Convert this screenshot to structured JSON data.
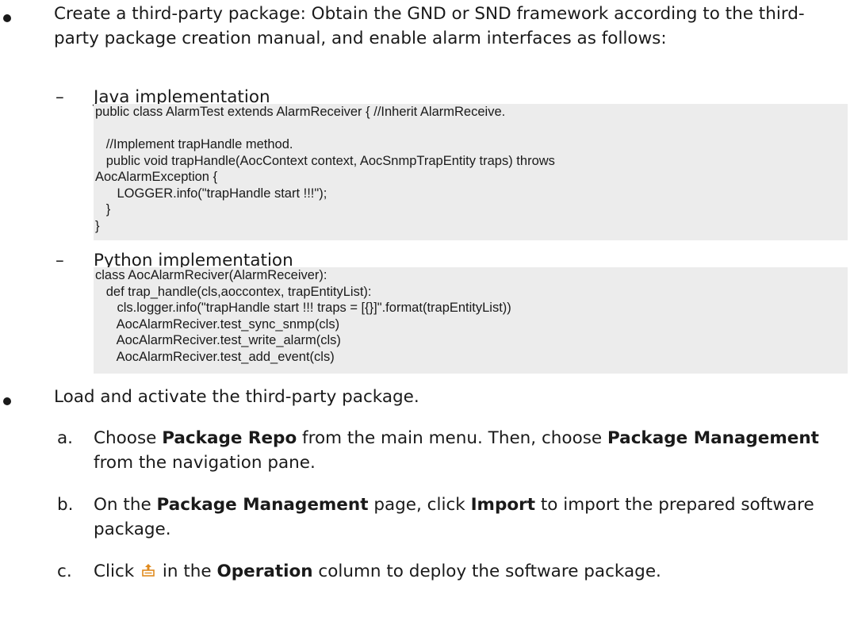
{
  "bullet1": {
    "text": "Create a third-party package: Obtain the GND or SND framework according to the third-party package creation manual, and enable alarm interfaces as follows:"
  },
  "java": {
    "heading": "Java implementation",
    "code": "public class AlarmTest extends AlarmReceiver { //Inherit AlarmReceive.\n\n   //Implement trapHandle method.\n   public void trapHandle(AocContext context, AocSnmpTrapEntity traps) throws\nAocAlarmException {\n      LOGGER.info(\"trapHandle start !!!\");\n   }\n}"
  },
  "python": {
    "heading": "Python implementation",
    "code": "class AocAlarmReciver(AlarmReceiver):\n   def trap_handle(cls,aoccontex, trapEntityList):\n      cls.logger.info(\"trapHandle start !!! traps = [{}]\".format(trapEntityList))\n      AocAlarmReciver.test_sync_snmp(cls)\n      AocAlarmReciver.test_write_alarm(cls)\n      AocAlarmReciver.test_add_event(cls)"
  },
  "bullet2": {
    "text": "Load and activate the third-party package."
  },
  "steps": [
    {
      "letter": "a.",
      "t1": "Choose ",
      "b1": "Package Repo",
      "t2": " from the main menu. Then, choose ",
      "b2": "Package Management",
      "t3": " from the navigation pane."
    },
    {
      "letter": "b.",
      "t1": "On the ",
      "b1": "Package Management",
      "t2": " page, click ",
      "b2": "Import",
      "t3": " to import the prepared software package."
    },
    {
      "letter": "c.",
      "t1": "Click ",
      "t2": " in the ",
      "b2": "Operation",
      "t3": " column to deploy the software package.",
      "icon": "deploy-icon"
    }
  ]
}
